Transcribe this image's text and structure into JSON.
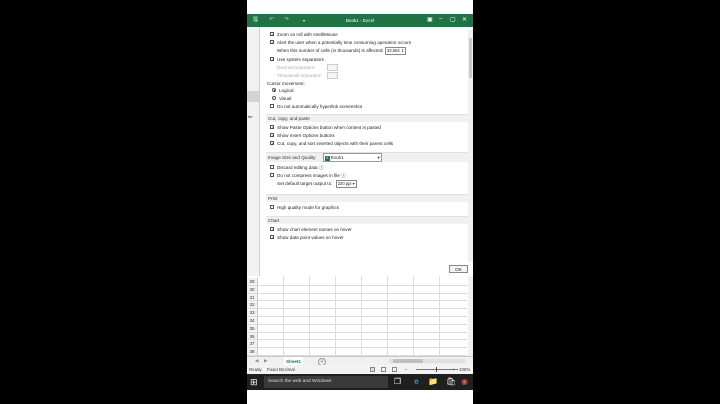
{
  "title_bar": {
    "title": "Book1 - Excel",
    "save_icon": "save-icon",
    "undo_icon": "undo-icon",
    "redo_icon": "redo-icon",
    "customize_icon": "customize-quick-access-icon",
    "accent": "#217346"
  },
  "left_strip_fragment": "ter",
  "options": {
    "zoom_on_roll": "Zoom on roll with IntelliMouse",
    "alert_slow": "Alert the user when a potentially time consuming operation occurs",
    "cells_affected_label": "When this number of cells (in thousands) is affected:",
    "cells_affected_value": "33,554",
    "use_system_separators": "Use system separators",
    "decimal_separator": "Decimal separator:",
    "thousands_separator": "Thousands separator:",
    "cursor_movement": "Cursor movement:",
    "logical": "Logical",
    "visual": "Visual",
    "no_hyperlink": "Do not automatically hyperlink screenshot",
    "section_cut_copy": "Cut, copy, and paste",
    "show_paste_options": "Show Paste Options button when content is pasted",
    "show_insert_options": "Show Insert Options buttons",
    "cut_copy_sort": "Cut, copy, and sort inserted objects with their parent cells",
    "section_image": "Image Size and Quality",
    "image_book": "Book1",
    "discard_editing": "Discard editing data",
    "no_compress": "Do not compress images in file",
    "default_output": "Set default target output to:",
    "default_output_value": "220 ppi",
    "section_print": "Print",
    "high_quality_mode": "High quality mode for graphics",
    "section_chart": "Chart",
    "show_chart_names": "Show chart element names on hover",
    "show_point_values": "Show data point values on hover",
    "ok": "OK"
  },
  "grid": {
    "rows": [
      "29",
      "30",
      "31",
      "32",
      "33",
      "34",
      "35",
      "36",
      "37",
      "38"
    ]
  },
  "sheet_tab": "Sheet1",
  "add_sheet": "+",
  "status": {
    "ready": "Ready",
    "mode": "Fixed Decimal",
    "zoom": "100%"
  },
  "taskbar": {
    "search_placeholder": "Search the web and Windows"
  }
}
